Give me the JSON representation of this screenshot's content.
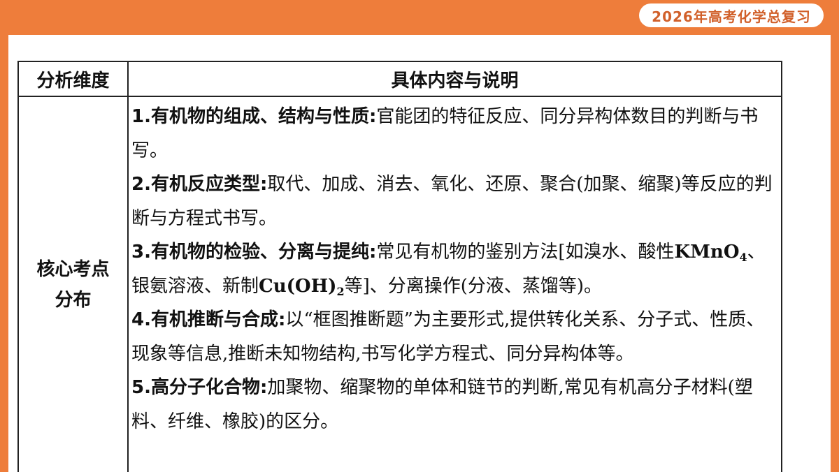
{
  "header": {
    "tag": "2026年高考化学总复习"
  },
  "table": {
    "headers": [
      "分析维度",
      "具体内容与说明"
    ],
    "dimension_line1": "核心考点",
    "dimension_line2": "分布",
    "items": [
      {
        "title": "1.有机物的组成、结构与性质:",
        "text": "官能团的特征反应、同分异构体数目的判断与书写。"
      },
      {
        "title": "2.有机反应类型:",
        "text": "取代、加成、消去、氧化、还原、聚合(加聚、缩聚)等反应的判断与方程式书写。"
      },
      {
        "title": "3.有机物的检验、分离与提纯:",
        "text_a": "常见有机物的鉴别方法[如溴水、酸性",
        "kmno4_a": "KMnO",
        "kmno4_sub": "4",
        "text_b": "、银氨溶液、新制",
        "cu_a": "Cu(OH)",
        "cu_sub": "2",
        "text_c": "等]、分离操作(分液、蒸馏等)。"
      },
      {
        "title": "4.有机推断与合成:",
        "text": "以“框图推断题”为主要形式,提供转化关系、分子式、性质、现象等信息,推断未知物结构,书写化学方程式、同分异构体等。"
      },
      {
        "title": "5.高分子化合物:",
        "text": "加聚物、缩聚物的单体和链节的判断,常见有机高分子材料(塑料、纤维、橡胶)的区分。"
      }
    ]
  },
  "colors": {
    "accent": "#ee7d3b",
    "tag_text": "#d1602a"
  }
}
